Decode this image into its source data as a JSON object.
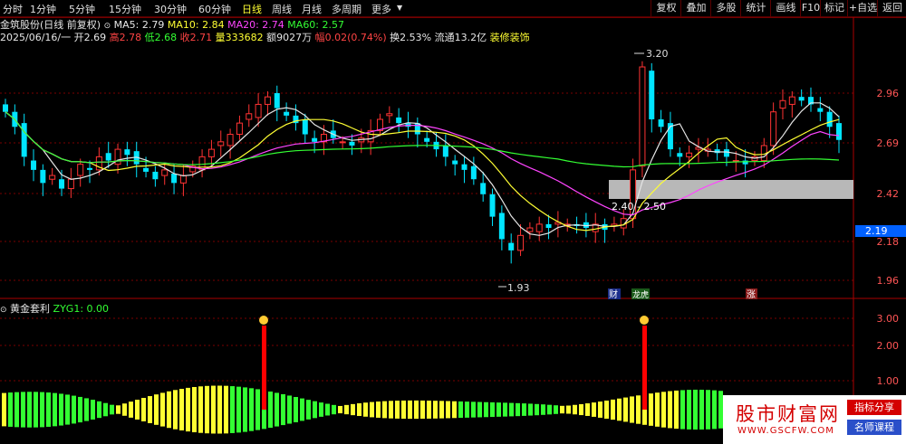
{
  "toolbar": {
    "periods": [
      "分时",
      "1分钟",
      "5分钟",
      "15分钟",
      "30分钟",
      "60分钟",
      "日线",
      "周线",
      "月线",
      "多周期",
      "更多"
    ],
    "active": "日线",
    "right_buttons": [
      "复权",
      "叠加",
      "多股",
      "统计",
      "画线",
      "F10",
      "标记",
      "+自选",
      "返回"
    ]
  },
  "header": {
    "stock": "金筑股份(日线 前复权)",
    "ma5": "MA5: 2.79",
    "ma10": "MA10: 2.84",
    "ma20": "MA20: 2.74",
    "ma60": "MA60: 2.57",
    "date": "2025/06/16/一",
    "open_label": "开",
    "open": "2.69",
    "high_label": "高",
    "high": "2.78",
    "low_label": "低",
    "low": "2.68",
    "close_label": "收",
    "close": "2.71",
    "vol_label": "量",
    "vol": "333682",
    "amt_label": "额",
    "amt": "9027万",
    "chg_label": "幅",
    "chg": "0.02(0.74%)",
    "turn_label": "换",
    "turn": "2.53%",
    "float_label": "流通",
    "float": "13.2亿",
    "industry": "装修装饰"
  },
  "price_axis": [
    "2.96",
    "2.69",
    "2.42",
    "2.18",
    "1.96"
  ],
  "price_tag": "2.19",
  "annotations": {
    "max": "3.20",
    "min": "1.93",
    "gap": "2.40 - 2.50"
  },
  "markers": {
    "cai": "财",
    "longhu": "龙虎",
    "zhang": "涨"
  },
  "subchart": {
    "name": "黄金套利",
    "value": "ZYG1: 0.00",
    "axis": [
      "3.00",
      "2.00",
      "1.00"
    ]
  },
  "watermark": {
    "title": "股市财富网",
    "url": "WWW.GSCFW.COM",
    "tag1": "指标分享",
    "tag2": "名师课程"
  },
  "colors": {
    "up": "#ff3333",
    "down": "#00e5ff",
    "ma5": "#e6e6e6",
    "ma10": "#ffff33",
    "ma20": "#ff44ff",
    "ma60": "#33ff33"
  }
}
